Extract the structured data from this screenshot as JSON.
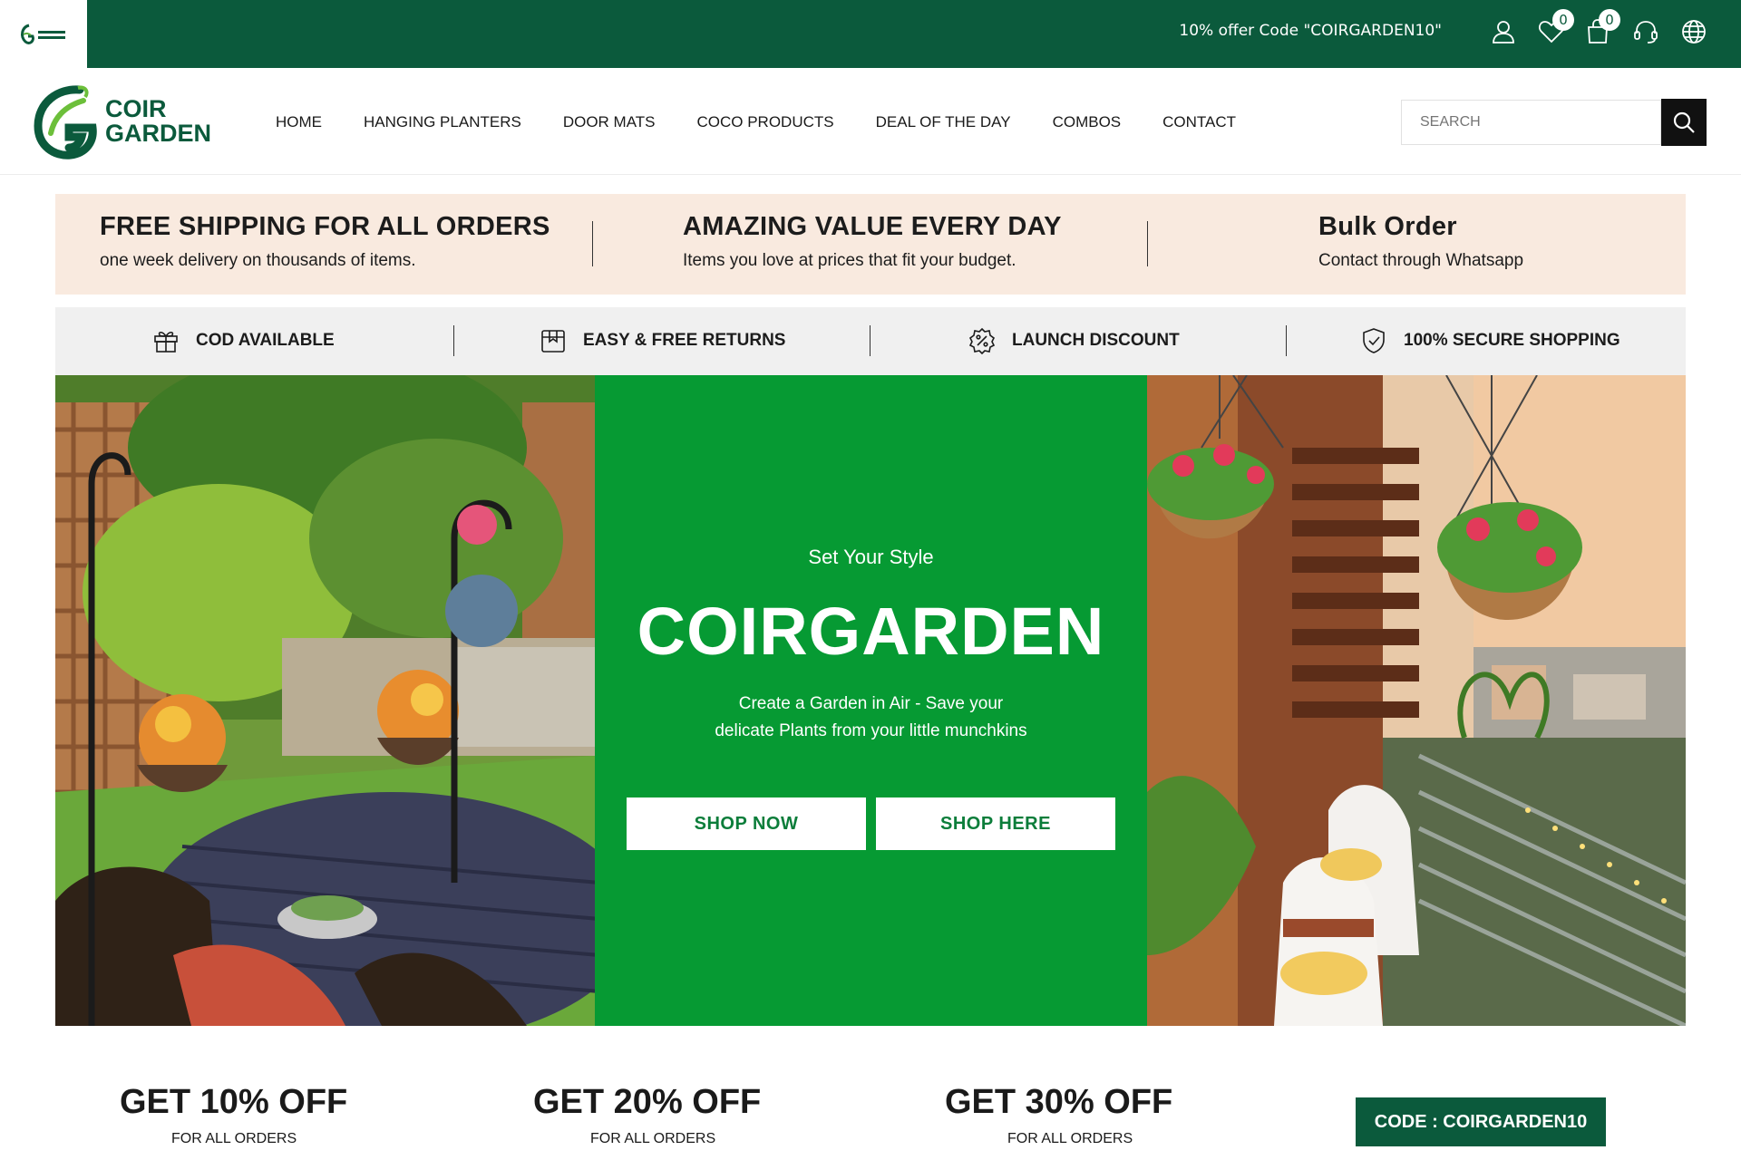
{
  "topbar": {
    "offer_text": "10% offer Code \"COIRGARDEN10\"",
    "wishlist_count": "0",
    "cart_count": "0"
  },
  "brand": {
    "line1": "COIR",
    "line2": "GARDEN",
    "color": "#0b5a3c"
  },
  "nav": {
    "items": [
      "HOME",
      "HANGING PLANTERS",
      "DOOR MATS",
      "COCO PRODUCTS",
      "DEAL OF THE DAY",
      "COMBOS",
      "CONTACT"
    ]
  },
  "search": {
    "placeholder": "SEARCH"
  },
  "promo": [
    {
      "title": "FREE SHIPPING FOR ALL ORDERS",
      "subtitle": "one week delivery on thousands of items."
    },
    {
      "title": "AMAZING VALUE EVERY DAY",
      "subtitle": "Items you love at prices that fit your budget."
    },
    {
      "title": "Bulk Order",
      "subtitle": "Contact through Whatsapp"
    }
  ],
  "features": [
    {
      "label": "COD AVAILABLE",
      "icon": "gift-icon"
    },
    {
      "label": "EASY & FREE RETURNS",
      "icon": "box-icon"
    },
    {
      "label": "LAUNCH DISCOUNT",
      "icon": "discount-badge-icon"
    },
    {
      "label": "100% SECURE SHOPPING",
      "icon": "shield-check-icon"
    }
  ],
  "hero": {
    "tagline": "Set Your Style",
    "title": "COIRGARDEN",
    "description_line1": "Create a Garden in Air - Save your",
    "description_line2": "delicate Plants from your little munchkins",
    "button_primary": "SHOP NOW",
    "button_secondary": "SHOP HERE",
    "background": "#069a33"
  },
  "offers": [
    {
      "title": "GET 10% OFF",
      "subtitle": "FOR ALL ORDERS",
      "highlight": "#fbd3dc"
    },
    {
      "title": "GET 20% OFF",
      "subtitle": "FOR ALL ORDERS",
      "highlight": "#fbe3d3"
    },
    {
      "title": "GET 30% OFF",
      "subtitle": "FOR ALL ORDERS",
      "highlight": "#fbd3d3"
    }
  ],
  "code_badge": "CODE : COIRGARDEN10"
}
